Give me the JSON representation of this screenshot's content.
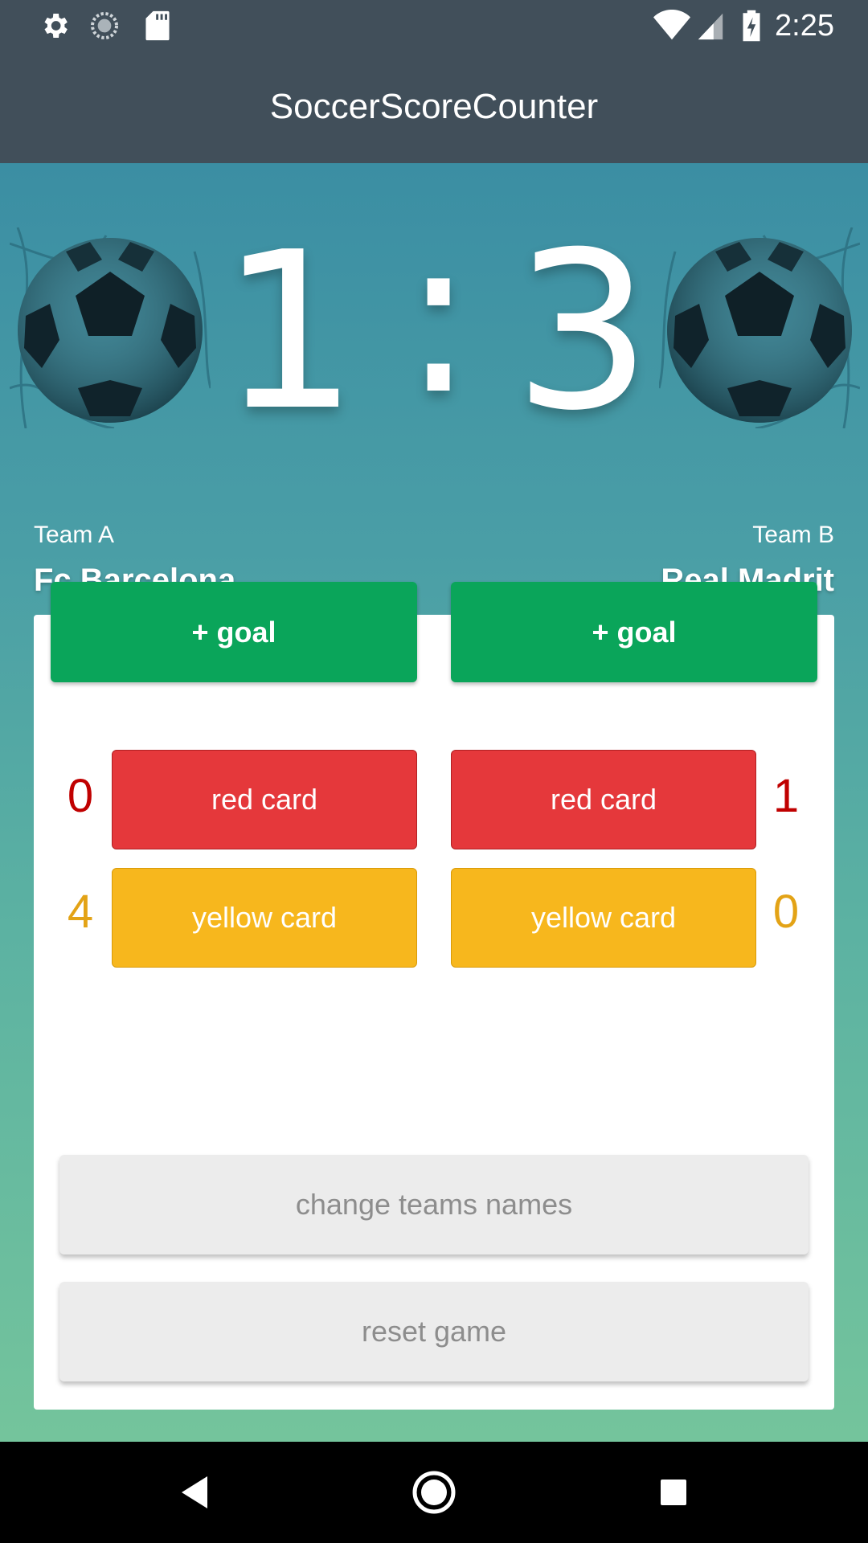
{
  "status_bar": {
    "time": "2:25",
    "left_icons": [
      "settings-icon",
      "sync-icon",
      "sd-card-icon"
    ],
    "right_icons": [
      "wifi-icon",
      "signal-icon",
      "battery-charging-icon"
    ]
  },
  "app_bar": {
    "title": "SoccerScoreCounter"
  },
  "scoreboard": {
    "team_a_score": "1",
    "separator": ":",
    "team_b_score": "3"
  },
  "teams": {
    "a": {
      "label": "Team A",
      "name": "Fc Barcelona",
      "red_cards": "0",
      "yellow_cards": "4"
    },
    "b": {
      "label": "Team B",
      "name": "Real Madrit",
      "red_cards": "1",
      "yellow_cards": "0"
    }
  },
  "buttons": {
    "goal": "+ goal",
    "red_card": "red card",
    "yellow_card": "yellow card",
    "change_names": "change teams names",
    "reset": "reset game"
  },
  "colors": {
    "app_bar": "#414f5a",
    "goal": "#0aa55a",
    "red_card": "#e5383b",
    "yellow_card": "#f7b71d",
    "red_count": "#c00000",
    "yellow_count": "#e3a316"
  },
  "nav_bar": {
    "icons": [
      "back-icon",
      "home-icon",
      "recents-icon"
    ]
  }
}
